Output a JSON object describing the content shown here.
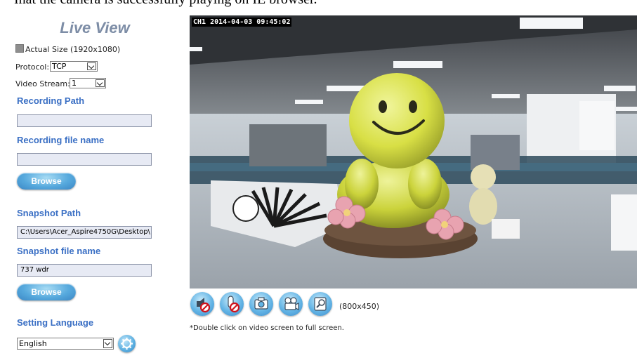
{
  "top_strip": {
    "text": "Ihat the camera is successfully playing on IE browser."
  },
  "sidebar": {
    "title": "Live View",
    "actual_size_label": "Actual Size (1920x1080)",
    "protocol": {
      "label": "Protocol:",
      "value": "TCP"
    },
    "video_stream": {
      "label": "Video Stream:",
      "value": "1"
    },
    "recording_path": {
      "heading": "Recording Path",
      "value": ""
    },
    "recording_file_name": {
      "heading": "Recording file name",
      "value": ""
    },
    "browse_label": "Browse",
    "snapshot_path": {
      "heading": "Snapshot Path",
      "value": "C:\\Users\\Acer_Aspire4750G\\Desktop\\"
    },
    "snapshot_file_name": {
      "heading": "Snapshot file name",
      "value": "737 wdr"
    },
    "setting_language": {
      "heading": "Setting Language",
      "value": "English"
    }
  },
  "video": {
    "osd": "CH1 2014-04-03 09:45:02",
    "resolution": "(800x450)",
    "hint": "*Double click on video screen to full screen."
  },
  "controls": {
    "icons": [
      "speaker-muted-icon",
      "microphone-muted-icon",
      "snapshot-camera-icon",
      "record-video-icon",
      "zoom-magnifier-icon"
    ]
  },
  "colors": {
    "section_heading": "#3a6fc4",
    "title": "#7d8da6",
    "button": "#56a9dd"
  }
}
